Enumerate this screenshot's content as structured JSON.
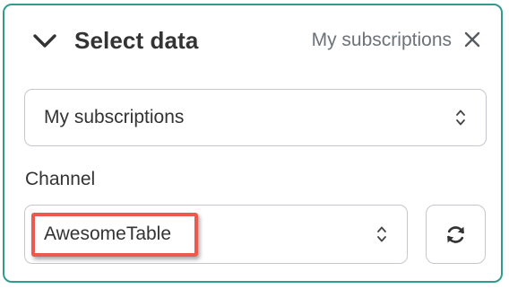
{
  "panel": {
    "title": "Select data",
    "summary": "My subscriptions",
    "collapse_icon": "chevron-down-icon",
    "close_icon": "close-icon",
    "border_color": "#2f9c8e"
  },
  "source_select": {
    "value": "My subscriptions",
    "icon": "chevron-up-down-icon"
  },
  "channel": {
    "label": "Channel",
    "value": "AwesomeTable",
    "icon": "chevron-up-down-icon",
    "highlight_color": "#ec5a4f"
  },
  "refresh_button": {
    "icon": "refresh-icon"
  }
}
